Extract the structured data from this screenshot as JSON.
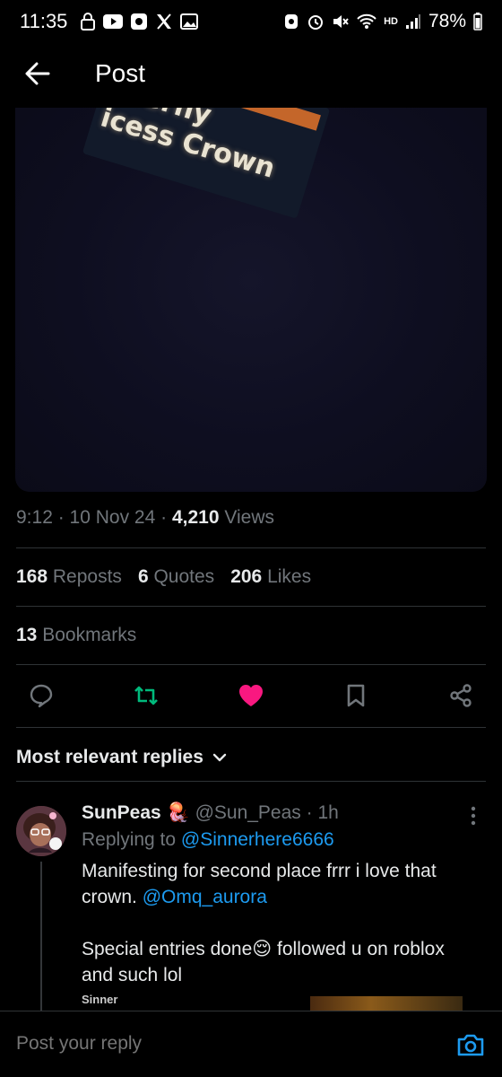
{
  "status_bar": {
    "time": "11:35",
    "battery": "78%",
    "network": "HD"
  },
  "header": {
    "title": "Post"
  },
  "media": {
    "caption_text": "Butterfly\nPrincess Crown",
    "visible_text": "itterfly\nicess Crown"
  },
  "post_meta": {
    "time": "9:12",
    "date": "10 Nov 24",
    "views_count": "4,210",
    "views_label": "Views"
  },
  "stats": {
    "reposts_count": "168",
    "reposts_label": "Reposts",
    "quotes_count": "6",
    "quotes_label": "Quotes",
    "likes_count": "206",
    "likes_label": "Likes",
    "bookmarks_count": "13",
    "bookmarks_label": "Bookmarks"
  },
  "actions": {
    "reply_icon": "speech-bubble",
    "repost_icon": "repost-arrows",
    "like_icon": "heart",
    "bookmark_icon": "bookmark",
    "share_icon": "share-nodes",
    "repost_color": "#00ba7c",
    "like_color": "#f91880"
  },
  "replies_header": {
    "label": "Most relevant replies"
  },
  "reply": {
    "name": "SunPeas",
    "handle": "@Sun_Peas",
    "age": "1h",
    "replying_label": "Replying to",
    "replying_handle": "@Sinnerhere6666",
    "body_line1": "Manifesting for second place frrr i love that crown.",
    "mention": "@Omq_aurora",
    "body_line2": "Special entries done",
    "body_line3": "followed u on roblox and such lol",
    "quote_author": "Sinner"
  },
  "composer": {
    "placeholder": "Post your reply"
  },
  "colors": {
    "accent": "#1d9bf0",
    "secondary_text": "#71767b",
    "divider": "#2f3336"
  }
}
